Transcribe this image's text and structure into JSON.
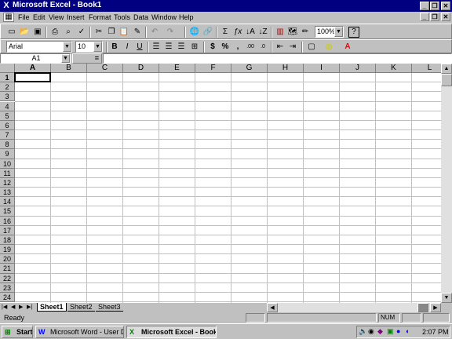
{
  "window": {
    "title": "Microsoft Excel - Book1",
    "logo_icon": "excel-logo-icon"
  },
  "menu": [
    "File",
    "Edit",
    "View",
    "Insert",
    "Format",
    "Tools",
    "Data",
    "Window",
    "Help"
  ],
  "toolbar": {
    "zoom": "100%"
  },
  "format_toolbar": {
    "font": "Arial",
    "size": "10"
  },
  "formula_bar": {
    "name_box": "A1",
    "equals": "=",
    "formula": ""
  },
  "grid": {
    "columns": [
      "A",
      "B",
      "C",
      "D",
      "E",
      "F",
      "G",
      "H",
      "I",
      "J",
      "K",
      "L"
    ],
    "rows": [
      "1",
      "2",
      "3",
      "4",
      "5",
      "6",
      "7",
      "8",
      "9",
      "10",
      "11",
      "12",
      "13",
      "14",
      "15",
      "16",
      "17",
      "18",
      "19",
      "20",
      "21",
      "22",
      "23",
      "24"
    ],
    "selected": "A1"
  },
  "sheets": {
    "tabs": [
      "Sheet1",
      "Sheet2",
      "Sheet3"
    ],
    "active": "Sheet1"
  },
  "status": {
    "text": "Ready",
    "num": "NUM"
  },
  "taskbar": {
    "start": "Start",
    "tasks": [
      "Microsoft Word - User Doc...",
      "Microsoft Excel - Book1"
    ],
    "time": "2:07 PM"
  }
}
